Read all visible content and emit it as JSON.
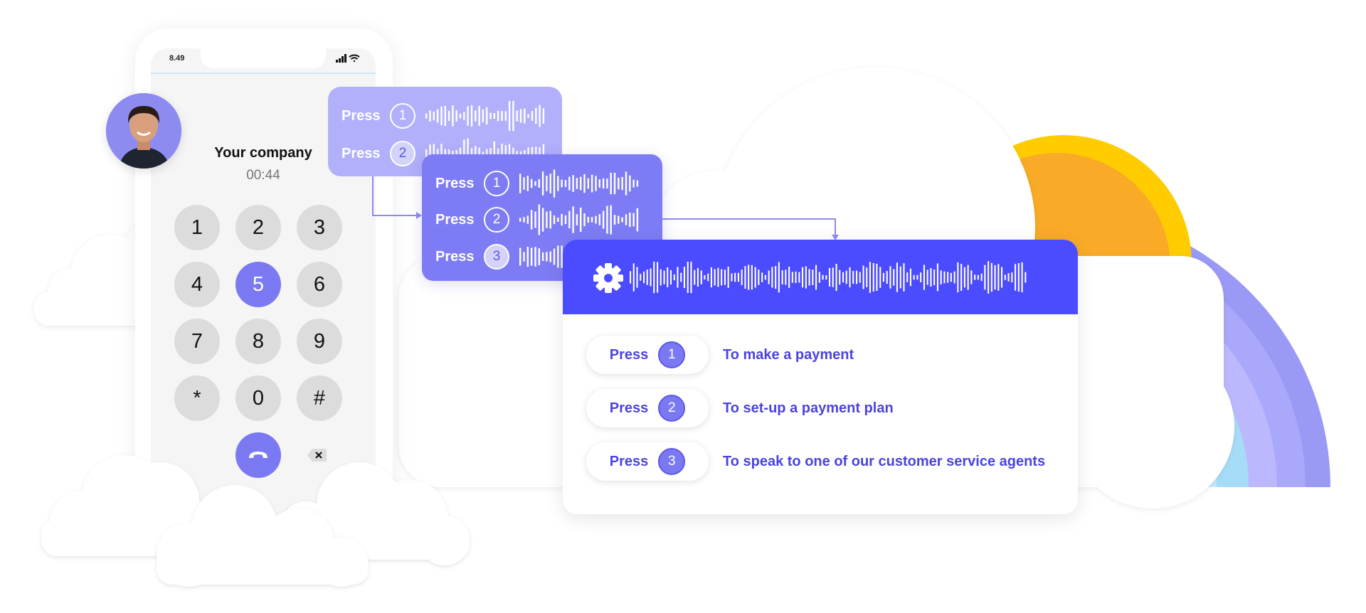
{
  "colors": {
    "accent": "#4b4bff",
    "accent_light": "#7b79f2",
    "card_light": "#b2b0fa",
    "card_mid": "#7e7cf4",
    "sun_outer": "#ffcc00",
    "sun_inner": "#f9ab27",
    "rainbow": [
      "#9a99f5",
      "#aaa8fa",
      "#bcb8fd",
      "#a7dcf8"
    ]
  },
  "phone": {
    "status_time": "8.49",
    "status_icons": [
      "signal-icon",
      "wifi-icon"
    ],
    "caller_name": "Your company",
    "call_duration": "00:44",
    "keypad": [
      "1",
      "2",
      "3",
      "4",
      "5",
      "6",
      "7",
      "8",
      "9",
      "*",
      "0",
      "#"
    ],
    "active_key": "5",
    "end_call_icon": "phone-hangup-icon",
    "backspace_icon": "backspace-icon"
  },
  "menu_card_1": {
    "rows": [
      {
        "label": "Press",
        "number": "1",
        "selected": false
      },
      {
        "label": "Press",
        "number": "2",
        "selected": true
      }
    ]
  },
  "menu_card_2": {
    "rows": [
      {
        "label": "Press",
        "number": "1",
        "selected": false
      },
      {
        "label": "Press",
        "number": "2",
        "selected": false
      },
      {
        "label": "Press",
        "number": "3",
        "selected": true
      }
    ]
  },
  "main_card": {
    "header_icon": "gear-icon",
    "options": [
      {
        "label": "Press",
        "number": "1",
        "text": "To make a payment"
      },
      {
        "label": "Press",
        "number": "2",
        "text": "To set-up a payment plan"
      },
      {
        "label": "Press",
        "number": "3",
        "text": "To speak to one of our customer service agents"
      }
    ]
  }
}
